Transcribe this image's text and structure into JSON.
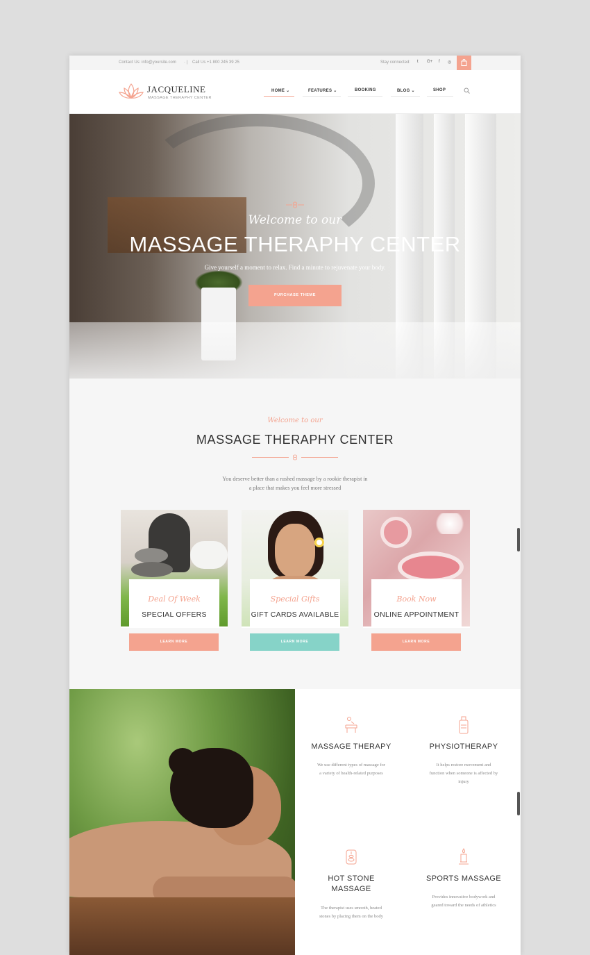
{
  "topbar": {
    "contact": "Contact Us: info@yoursite.com",
    "phone": "Call Us +1 800 245 39 25",
    "stay": "Stay connected:",
    "social": [
      "twitter-icon",
      "google-plus-icon",
      "facebook-icon",
      "instagram-icon"
    ]
  },
  "brand": {
    "name": "JACQUELINE",
    "tagline": "MASSAGE THERAPHY CENTER"
  },
  "nav": {
    "items": [
      {
        "label": "HOME",
        "has_dropdown": true,
        "active": true
      },
      {
        "label": "FEATURES",
        "has_dropdown": true,
        "active": false
      },
      {
        "label": "BOOKING",
        "has_dropdown": false,
        "active": false
      },
      {
        "label": "BLOG",
        "has_dropdown": true,
        "active": false
      },
      {
        "label": "SHOP",
        "has_dropdown": false,
        "active": false
      }
    ]
  },
  "hero": {
    "script": "Welcome to our",
    "title": "MASSAGE THERAPHY CENTER",
    "subtitle": "Give yourself a moment to relax. Find a minute to rejuvenate your body.",
    "cta": "PURCHASE THEME"
  },
  "intro": {
    "script": "Welcome to our",
    "title": "MASSAGE THERAPHY CENTER",
    "desc_line1": "You deserve better than a rushed massage by a rookie therapist in",
    "desc_line2": "a place that makes you feel more stressed"
  },
  "cards": [
    {
      "script": "Deal Of Week",
      "title": "SPECIAL OFFERS",
      "button": "LEARN MORE",
      "button_color": "#f4a38f"
    },
    {
      "script": "Special Gifts",
      "title": "GIFT CARDS AVAILABLE",
      "button": "LEARN MORE",
      "button_color": "#86d3c8"
    },
    {
      "script": "Book Now",
      "title": "ONLINE APPOINTMENT",
      "button": "LEARN MORE",
      "button_color": "#f4a38f"
    }
  ],
  "services": [
    {
      "name": "MASSAGE THERAPY",
      "line1": "We use different types of massage for",
      "line2": "a variety of health-related purposes",
      "line3": "",
      "icon": "massage-table-icon"
    },
    {
      "name": "PHYSIOTHERAPY",
      "line1": "It helps restore movement and",
      "line2": "function when someone is affected by",
      "line3": "injury",
      "icon": "bottle-icon"
    },
    {
      "name": "HOT STONE",
      "name2": "MASSAGE",
      "line1": "The therapist uses smooth, heated",
      "line2": "stones by placing them on the body",
      "line3": "",
      "icon": "stones-icon"
    },
    {
      "name": "SPORTS MASSAGE",
      "line1": "Provides innovative bodywork and",
      "line2": "geared toward the needs of athletics",
      "line3": "",
      "icon": "candle-icon"
    }
  ],
  "colors": {
    "accent": "#f4a38f",
    "teal": "#86d3c8",
    "text": "#333333"
  }
}
